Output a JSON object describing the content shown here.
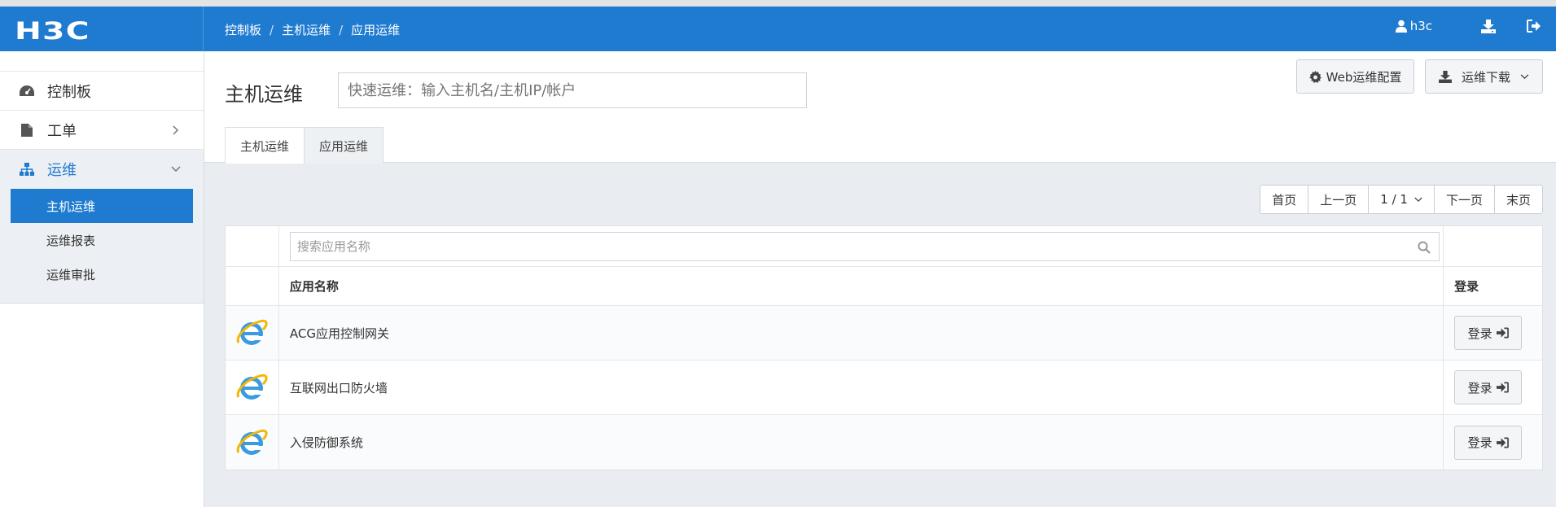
{
  "header": {
    "logo": "H3C",
    "breadcrumb": [
      "控制板",
      "主机运维",
      "应用运维"
    ],
    "user": "h3c",
    "icons": [
      "user-icon",
      "download-icon",
      "logout-icon"
    ]
  },
  "sidebar": {
    "items": [
      {
        "label": "控制板",
        "icon": "dashboard-icon"
      },
      {
        "label": "工单",
        "icon": "file-icon"
      },
      {
        "label": "运维",
        "icon": "sitemap-icon"
      }
    ],
    "subitems": [
      "主机运维",
      "运维报表",
      "运维审批"
    ]
  },
  "main": {
    "title": "主机运维",
    "quick_placeholder": "快速运维：输入主机名/主机IP/帐户",
    "web_config": "Web运维配置",
    "download": "运维下载",
    "tabs": [
      "主机运维",
      "应用运维"
    ]
  },
  "pager": {
    "first": "首页",
    "prev": "上一页",
    "page": "1 / 1",
    "next": "下一页",
    "last": "末页"
  },
  "table": {
    "search_placeholder": "搜索应用名称",
    "col_name": "应用名称",
    "col_login": "登录",
    "rows": [
      {
        "name": "ACG应用控制网关",
        "action": "登录"
      },
      {
        "name": "互联网出口防火墙",
        "action": "登录"
      },
      {
        "name": "入侵防御系统",
        "action": "登录"
      }
    ]
  },
  "colors": {
    "primary": "#1f7bcf",
    "background": "#e9edf1"
  }
}
